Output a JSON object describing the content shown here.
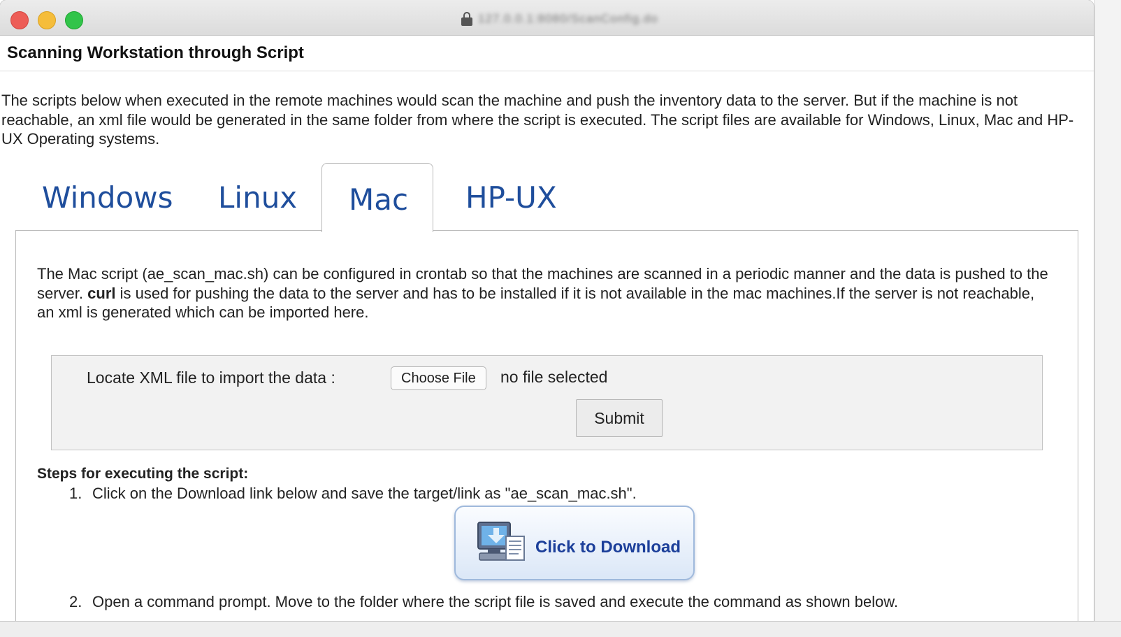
{
  "window": {
    "url": "127.0.0.1:8080/ScanConfig.do"
  },
  "header": {
    "title": "Scanning Workstation through Script"
  },
  "intro": {
    "text": "The scripts below when executed in the remote machines would scan the machine and push the inventory data to the server. But if the machine is not reachable, an xml file would be generated in the same folder from where the script is executed. The script files are available for Windows, Linux, Mac and HP-UX Operating systems."
  },
  "tabs": [
    {
      "label": "Windows",
      "active": false
    },
    {
      "label": "Linux",
      "active": false
    },
    {
      "label": "Mac",
      "active": true
    },
    {
      "label": "HP-UX",
      "active": false
    }
  ],
  "mac": {
    "desc_part1": "The Mac script (ae_scan_mac.sh) can be configured in crontab so that the machines are scanned in a periodic manner and the data is pushed to the server. ",
    "desc_bold": "curl",
    "desc_part2": " is used for pushing the data to the server and has to be installed if it is not available in the mac machines.If the server is not reachable, an xml is generated which can be imported here.",
    "import_label": "Locate XML file to import the data :",
    "choose_file_label": "Choose File",
    "file_status": "no file selected",
    "submit_label": "Submit",
    "steps_title": "Steps for executing the script:",
    "steps": [
      {
        "num": "1.",
        "text": "Click on the Download link below and save the target/link as \"ae_scan_mac.sh\"."
      },
      {
        "num": "2.",
        "text": "Open a command prompt. Move to the folder where the script file is saved and execute the command as shown below."
      }
    ],
    "download_label": "Click to Download"
  },
  "colors": {
    "tab_text": "#1f4e9c",
    "download_text": "#1c3f9a",
    "close": "#ed5d57",
    "minimize": "#f5bd3b",
    "maximize": "#32c44a"
  }
}
